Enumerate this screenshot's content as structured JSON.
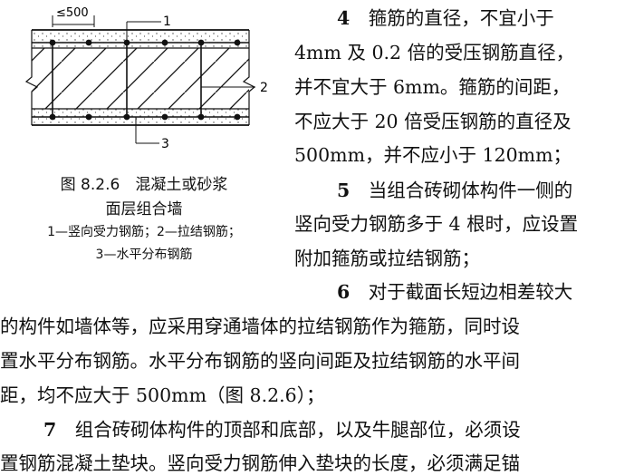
{
  "figure": {
    "dim_label": "≤500",
    "callouts": [
      "1",
      "2",
      "3"
    ],
    "caption_title": "图 8.2.6　混凝土或砂浆",
    "caption_title2": "面层组合墙",
    "legend1": "1—竖向受力钢筋；2—拉结钢筋；",
    "legend2": "3—水平分布钢筋"
  },
  "text": {
    "r1_num": "4",
    "r1": "　箍筋的直径，不宜小于",
    "r2": "4mm 及 0.2 倍的受压钢筋直径，",
    "r3": "并不宜大于 6mm。箍筋的间距，",
    "r4": "不应大于 20 倍受压钢筋的直径及",
    "r5": "500mm，并不应小于 120mm；",
    "r6_num": "5",
    "r6": "　当组合砖砌体构件一侧的",
    "r7": "竖向受力钢筋多于 4 根时，应设置",
    "r8": "附加箍筋或拉结钢筋；",
    "r9_num": "6",
    "r9": "　对于截面长短边相差较大",
    "f1": "的构件如墙体等，应采用穿通墙体的拉结钢筋作为箍筋，同时设",
    "f2": "置水平分布钢筋。水平分布钢筋的竖向间距及拉结钢筋的水平间",
    "f3": "距，均不应大于 500mm（图 8.2.6）；",
    "f4_num": "7",
    "f4": "　组合砖砌体构件的顶部和底部，以及牛腿部位，必须设",
    "f5": "置钢筋混凝土垫块。竖向受力钢筋伸入垫块的长度，必须满足锚"
  }
}
